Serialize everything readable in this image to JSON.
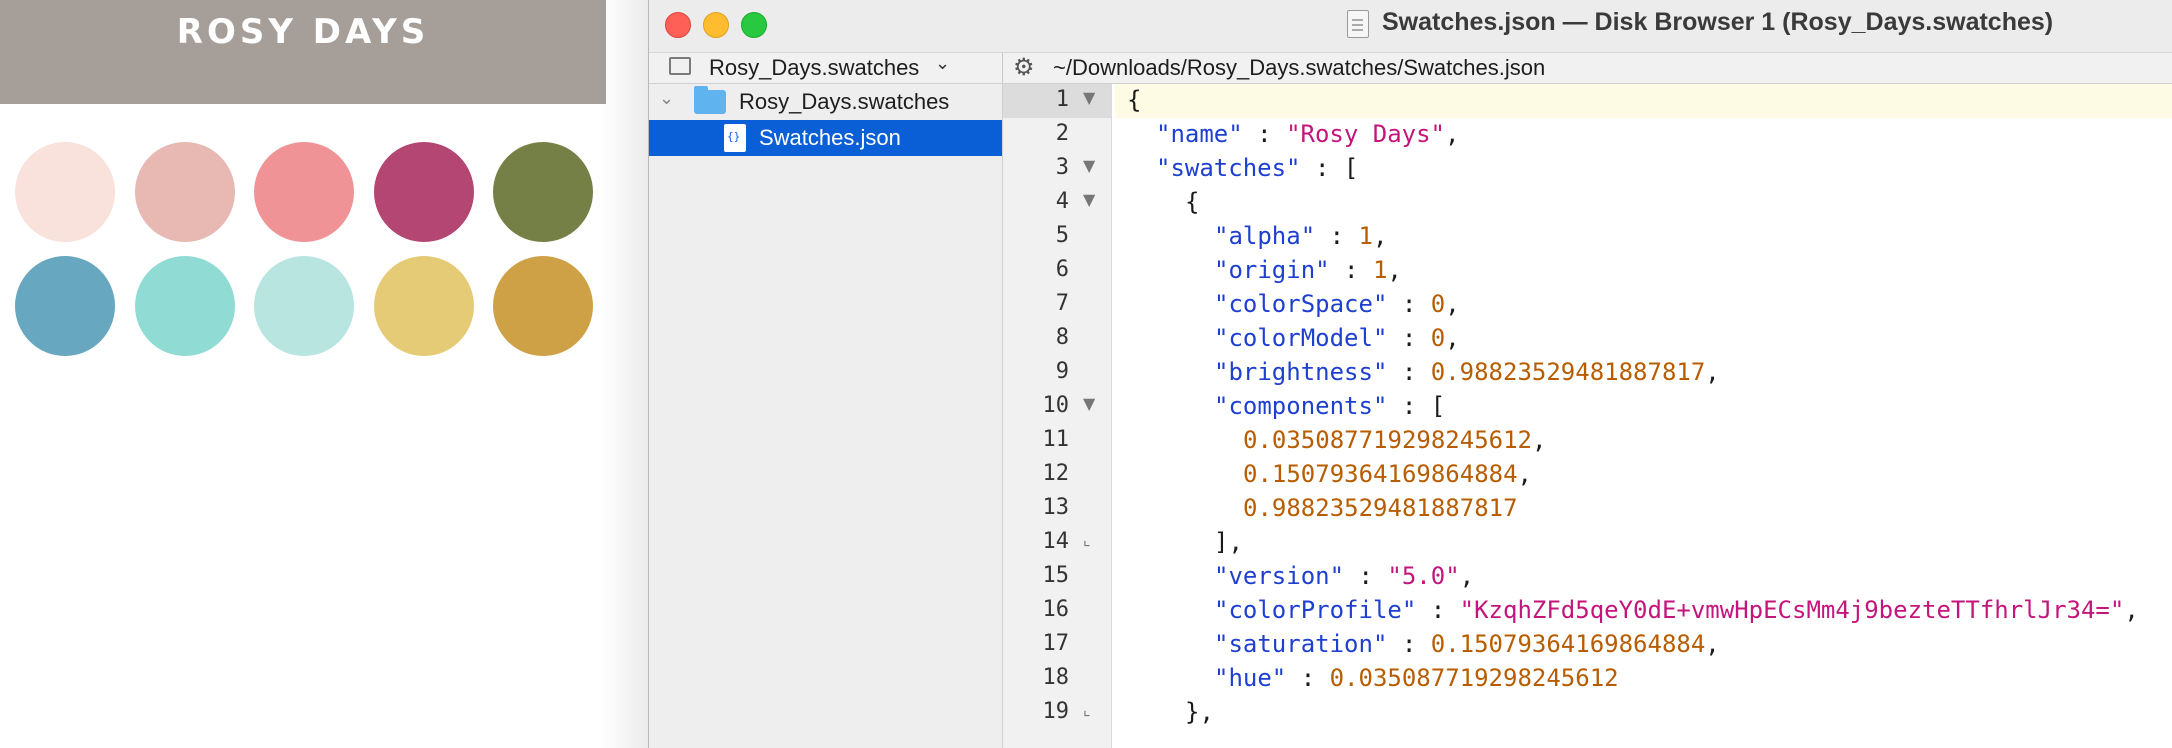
{
  "palette": {
    "title": "ROSY DAYS",
    "swatch_colors": [
      "#f9e1dc",
      "#e8b9b3",
      "#ef9396",
      "#b44673",
      "#758046",
      "#68a7c0",
      "#90dcd4",
      "#b9e5e0",
      "#e6cb76",
      "#cea147"
    ]
  },
  "window": {
    "title": "Swatches.json — Disk Browser 1 (Rosy_Days.swatches)",
    "icons": [
      "close-button",
      "minimize-button",
      "zoom-button",
      "document-icon"
    ]
  },
  "toolbar": {
    "folder_label": "Rosy_Days.swatches",
    "path": "~/Downloads/Rosy_Days.swatches/Swatches.json"
  },
  "sidebar": {
    "items": [
      {
        "label": "Rosy_Days.swatches",
        "type": "folder",
        "expanded": true
      },
      {
        "label": "Swatches.json",
        "type": "file",
        "selected": true
      }
    ]
  },
  "editor": {
    "lines": [
      {
        "n": "1",
        "t": "{"
      },
      {
        "n": "2",
        "k": "\"name\"",
        "sep": " : ",
        "s": "\"Rosy Days\"",
        "end": ","
      },
      {
        "n": "3",
        "k": "\"swatches\"",
        "sep": " : ",
        "end": "["
      },
      {
        "n": "4",
        "t": "{"
      },
      {
        "n": "5",
        "k": "\"alpha\"",
        "sep": " : ",
        "v": "1",
        "end": ","
      },
      {
        "n": "6",
        "k": "\"origin\"",
        "sep": " : ",
        "v": "1",
        "end": ","
      },
      {
        "n": "7",
        "k": "\"colorSpace\"",
        "sep": " : ",
        "v": "0",
        "end": ","
      },
      {
        "n": "8",
        "k": "\"colorModel\"",
        "sep": " : ",
        "v": "0",
        "end": ","
      },
      {
        "n": "9",
        "k": "\"brightness\"",
        "sep": " : ",
        "v": "0.98823529481887817",
        "end": ","
      },
      {
        "n": "10",
        "k": "\"components\"",
        "sep": " : ",
        "end": "["
      },
      {
        "n": "11",
        "v": "0.035087719298245612",
        "end": ","
      },
      {
        "n": "12",
        "v": "0.15079364169864884",
        "end": ","
      },
      {
        "n": "13",
        "v": "0.98823529481887817"
      },
      {
        "n": "14",
        "t": "],"
      },
      {
        "n": "15",
        "k": "\"version\"",
        "sep": " : ",
        "s": "\"5.0\"",
        "end": ","
      },
      {
        "n": "16",
        "k": "\"colorProfile\"",
        "sep": " : ",
        "s": "\"KzqhZFd5qeY0dE+vmwHpECsMm4j9bezteTTfhrlJr34=\"",
        "end": ","
      },
      {
        "n": "17",
        "k": "\"saturation\"",
        "sep": " : ",
        "v": "0.15079364169864884",
        "end": ","
      },
      {
        "n": "18",
        "k": "\"hue\"",
        "sep": " : ",
        "v": "0.035087719298245612"
      },
      {
        "n": "19",
        "t": "},"
      }
    ]
  }
}
